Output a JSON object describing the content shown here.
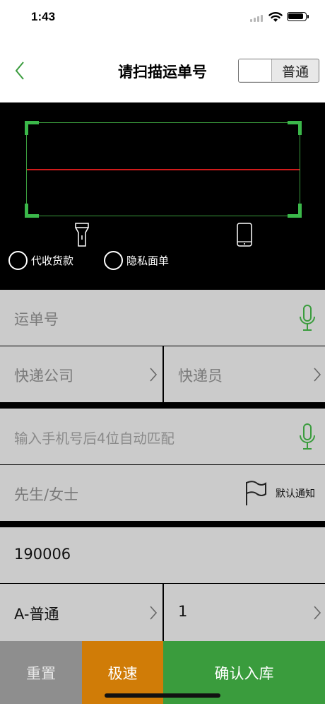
{
  "status_bar": {
    "time": "1:43"
  },
  "nav": {
    "title": "请扫描运单号",
    "mode_label": "普通"
  },
  "scanner": {
    "options": [
      "代收货款",
      "隐私面单"
    ]
  },
  "form": {
    "waybill_placeholder": "运单号",
    "courier_company_placeholder": "快递公司",
    "courier_placeholder": "快递员",
    "phone_placeholder": "输入手机号后4位自动匹配",
    "name_placeholder": "先生/女士",
    "notify_label": "默认通知",
    "code_value": "190006",
    "category_value": "A-普通",
    "quantity_value": "1"
  },
  "buttons": {
    "reset": "重置",
    "fast": "极速",
    "confirm": "确认入库"
  },
  "colors": {
    "accent_green": "#3a9c3d",
    "fast_orange": "#d07c07",
    "reset_gray": "#8e8e8e",
    "scan_line_red": "#d11b1b"
  }
}
